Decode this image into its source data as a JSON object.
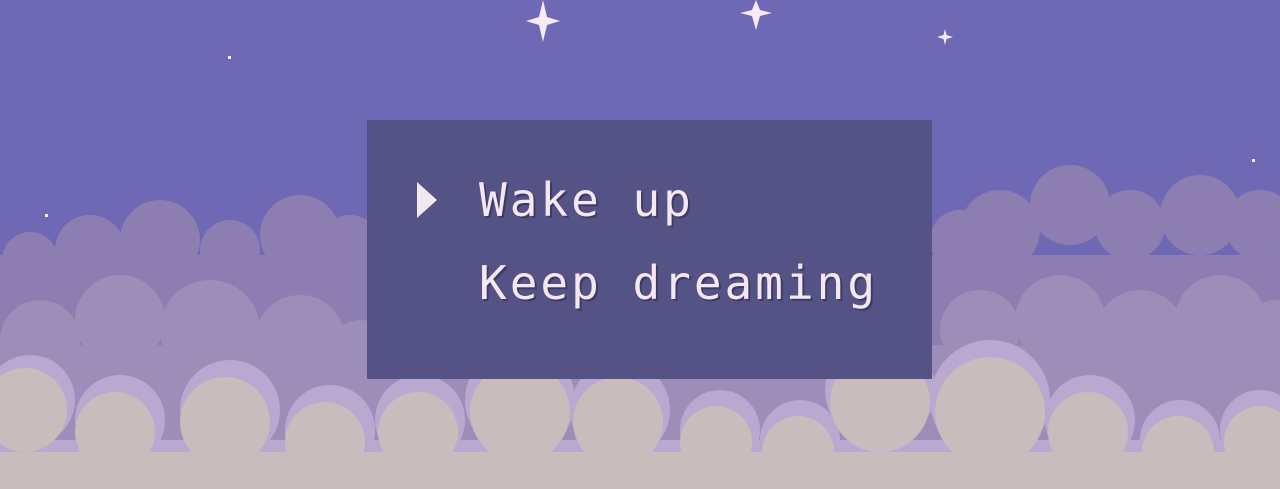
{
  "scene": {
    "sky_color": "#6f69b5",
    "cloud_colors": [
      "#8c7eb0",
      "#9c8ab6",
      "#b8a8cf",
      "#c9bcbc"
    ],
    "star_color": "#f7eaf4"
  },
  "menu": {
    "panel_color": "#555386",
    "text_color": "#f5e7f0",
    "selected_index": 0,
    "cursor_icon": "triangle-right-icon",
    "options": [
      {
        "label": "Wake up"
      },
      {
        "label": "Keep dreaming"
      }
    ]
  }
}
